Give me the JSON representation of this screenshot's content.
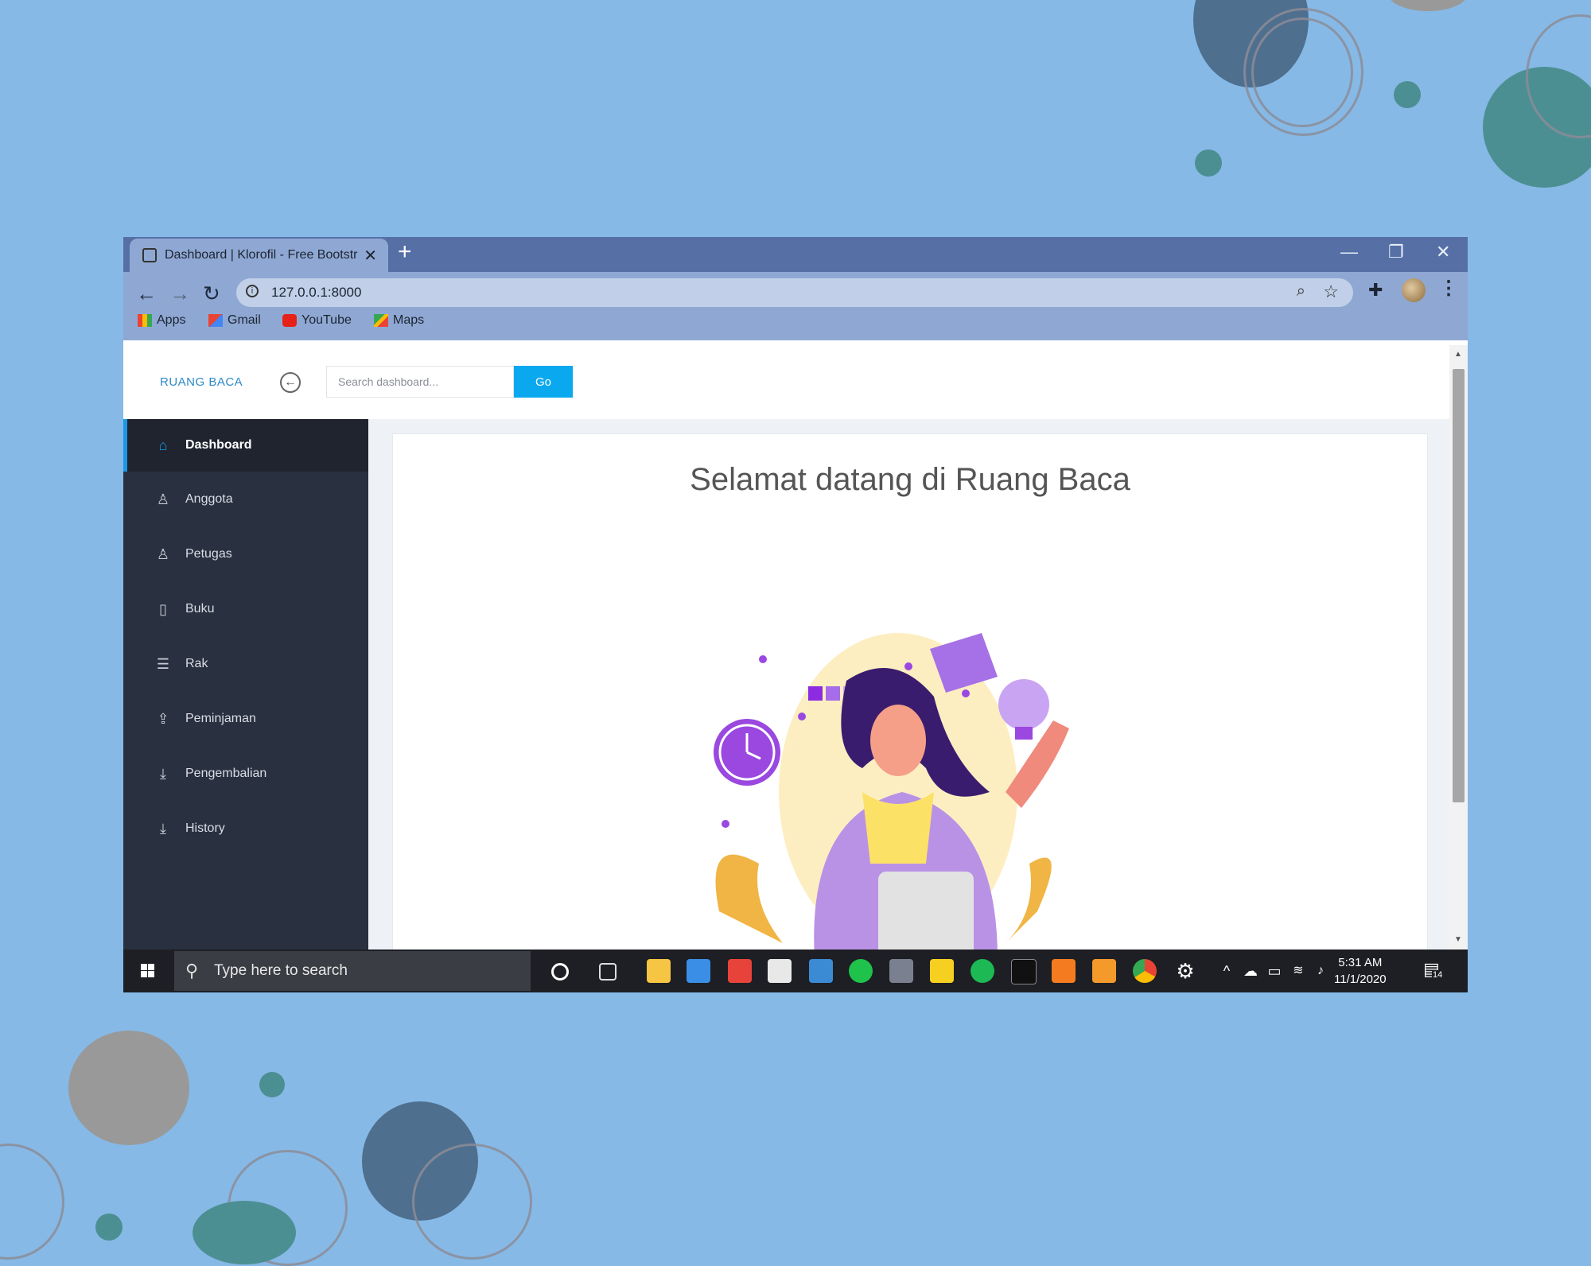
{
  "browser": {
    "tab_title": "Dashboard | Klorofil - Free Bootstr",
    "url": "127.0.0.1:8000",
    "bookmarks": [
      {
        "label": "Apps",
        "icon": "apps-grid-icon"
      },
      {
        "label": "Gmail",
        "icon": "gmail-icon"
      },
      {
        "label": "YouTube",
        "icon": "youtube-icon"
      },
      {
        "label": "Maps",
        "icon": "maps-icon"
      }
    ]
  },
  "app": {
    "brand": "RUANG BACA",
    "search": {
      "placeholder": "Search dashboard...",
      "value": ""
    },
    "go_label": "Go",
    "sidebar": {
      "items": [
        {
          "label": "Dashboard",
          "icon": "home-icon",
          "active": true
        },
        {
          "label": "Anggota",
          "icon": "user-icon",
          "active": false
        },
        {
          "label": "Petugas",
          "icon": "user-icon",
          "active": false
        },
        {
          "label": "Buku",
          "icon": "book-icon",
          "active": false
        },
        {
          "label": "Rak",
          "icon": "list-icon",
          "active": false
        },
        {
          "label": "Peminjaman",
          "icon": "upload-icon",
          "active": false
        },
        {
          "label": "Pengembalian",
          "icon": "download-icon",
          "active": false
        },
        {
          "label": "History",
          "icon": "download-icon",
          "active": false
        }
      ]
    },
    "welcome": "Selamat datang di Ruang Baca"
  },
  "taskbar": {
    "search_placeholder": "Type here to search",
    "time": "5:31 AM",
    "date": "11/1/2020",
    "notification_count": "14"
  },
  "colors": {
    "accent": "#0aa8ef",
    "sidebar_bg": "#293040",
    "page_bg": "#86b9e6"
  }
}
